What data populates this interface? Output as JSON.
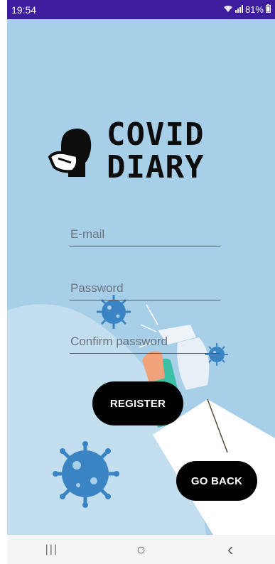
{
  "status_bar": {
    "time": "19:54",
    "battery": "81%",
    "icons": [
      "wifi-icon",
      "signal-icon",
      "battery-icon"
    ]
  },
  "logo": {
    "line1": "COVID",
    "line2": "DIARY",
    "icon": "masked-head-icon"
  },
  "form": {
    "email_placeholder": "E-mail",
    "email_value": "",
    "password_placeholder": "Password",
    "password_value": "",
    "confirm_placeholder": "Confirm password",
    "confirm_value": ""
  },
  "buttons": {
    "register_label": "REGISTER",
    "goback_label": "GO BACK"
  },
  "nav": {
    "recents_symbol": "|||",
    "home_symbol": "○",
    "back_symbol": "‹"
  },
  "colors": {
    "status_bar": "#3d1d9e",
    "background": "#a8cfe8",
    "virus": "#3b84c4",
    "button": "#000000"
  }
}
